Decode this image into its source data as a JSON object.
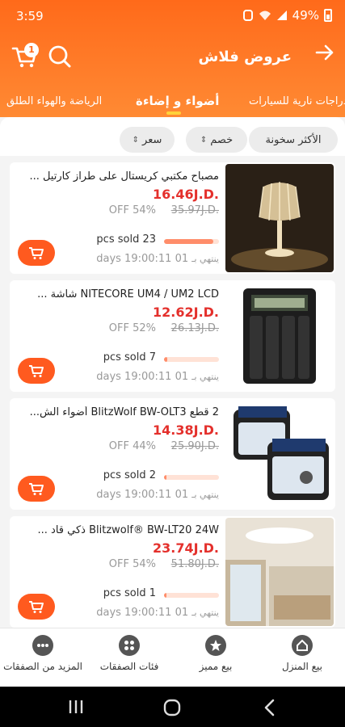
{
  "status_bar": {
    "time": "3:59",
    "battery": "49%"
  },
  "header": {
    "title": "عروض فلاش",
    "cart_count": "1"
  },
  "tabs": [
    {
      "label": "الرياضة والهواء الطلق"
    },
    {
      "label": "أضواء و إضاءة"
    },
    {
      "label": "دراجات نارية للسيارات"
    }
  ],
  "filters": [
    {
      "label": "الأكثر سخونة"
    },
    {
      "label": "خصم"
    },
    {
      "label": "سعر"
    }
  ],
  "products": [
    {
      "name": "مصباح مكتبي كريستال على طراز كارتيل ...",
      "price": "16.46J.D.",
      "old_price": "35.97J.D.",
      "discount": "OFF 54%",
      "sold": "pcs sold 23",
      "sold_level": 0.9,
      "ends_label": "ينتهي بـ",
      "ends_value": "days 19:00:11 01"
    },
    {
      "name": "NITECORE UM4 / UM2 LCD شاشة ...",
      "price": "12.62J.D.",
      "old_price": "26.13J.D.",
      "discount": "OFF 52%",
      "sold": "pcs sold 7",
      "sold_level": 0.06,
      "ends_label": "ينتهي بـ",
      "ends_value": "days 19:00:11 01"
    },
    {
      "name": "2 قطع BlitzWolf BW-OLT3 أضواء الش...",
      "price": "14.38J.D.",
      "old_price": "25.90J.D.",
      "discount": "OFF 44%",
      "sold": "pcs sold 2",
      "sold_level": 0.03,
      "ends_label": "ينتهي بـ",
      "ends_value": "days 19:00:11 01"
    },
    {
      "name": "Blitzwolf® BW-LT20 24W ذكي قاد ...",
      "price": "23.74J.D.",
      "old_price": "51.80J.D.",
      "discount": "OFF 54%",
      "sold": "pcs sold 1",
      "sold_level": 0.02,
      "ends_label": "ينتهي بـ",
      "ends_value": "days 19:00:11 01"
    }
  ],
  "bottom_nav": [
    {
      "label": "بيع المنزل",
      "icon": "home-icon"
    },
    {
      "label": "بيع مميز",
      "icon": "star-icon"
    },
    {
      "label": "فئات الصفقات",
      "icon": "grid-icon"
    },
    {
      "label": "المزيد من الصفقات",
      "icon": "more-icon"
    }
  ],
  "colors": {
    "accent": "#ff6a1a",
    "price": "#e4302c",
    "cart_button": "#ff5a1f",
    "tab_indicator": "#ffd23a"
  }
}
